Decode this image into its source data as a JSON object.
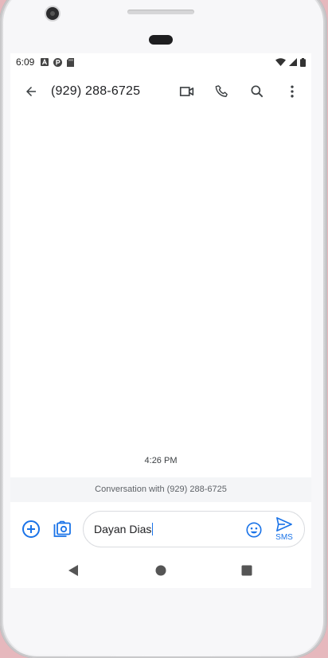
{
  "status_bar": {
    "time": "6:09",
    "left_icons": [
      "a-notification-icon",
      "p-notification-icon",
      "sd-card-icon"
    ],
    "right_icons": [
      "wifi-icon",
      "signal-icon",
      "battery-icon"
    ]
  },
  "app_bar": {
    "title": "(929) 288-6725",
    "actions": [
      "video-call-icon",
      "phone-icon",
      "search-icon",
      "more-vert-icon"
    ]
  },
  "conversation": {
    "timestamp": "4:26 PM",
    "info_banner": "Conversation with (929) 288-6725"
  },
  "composer": {
    "input_value": "Dayan Dias",
    "send_label": "SMS"
  },
  "colors": {
    "accent": "#1a73e8",
    "icon_gray": "#5f6368",
    "banner_bg": "#f4f5f7"
  }
}
